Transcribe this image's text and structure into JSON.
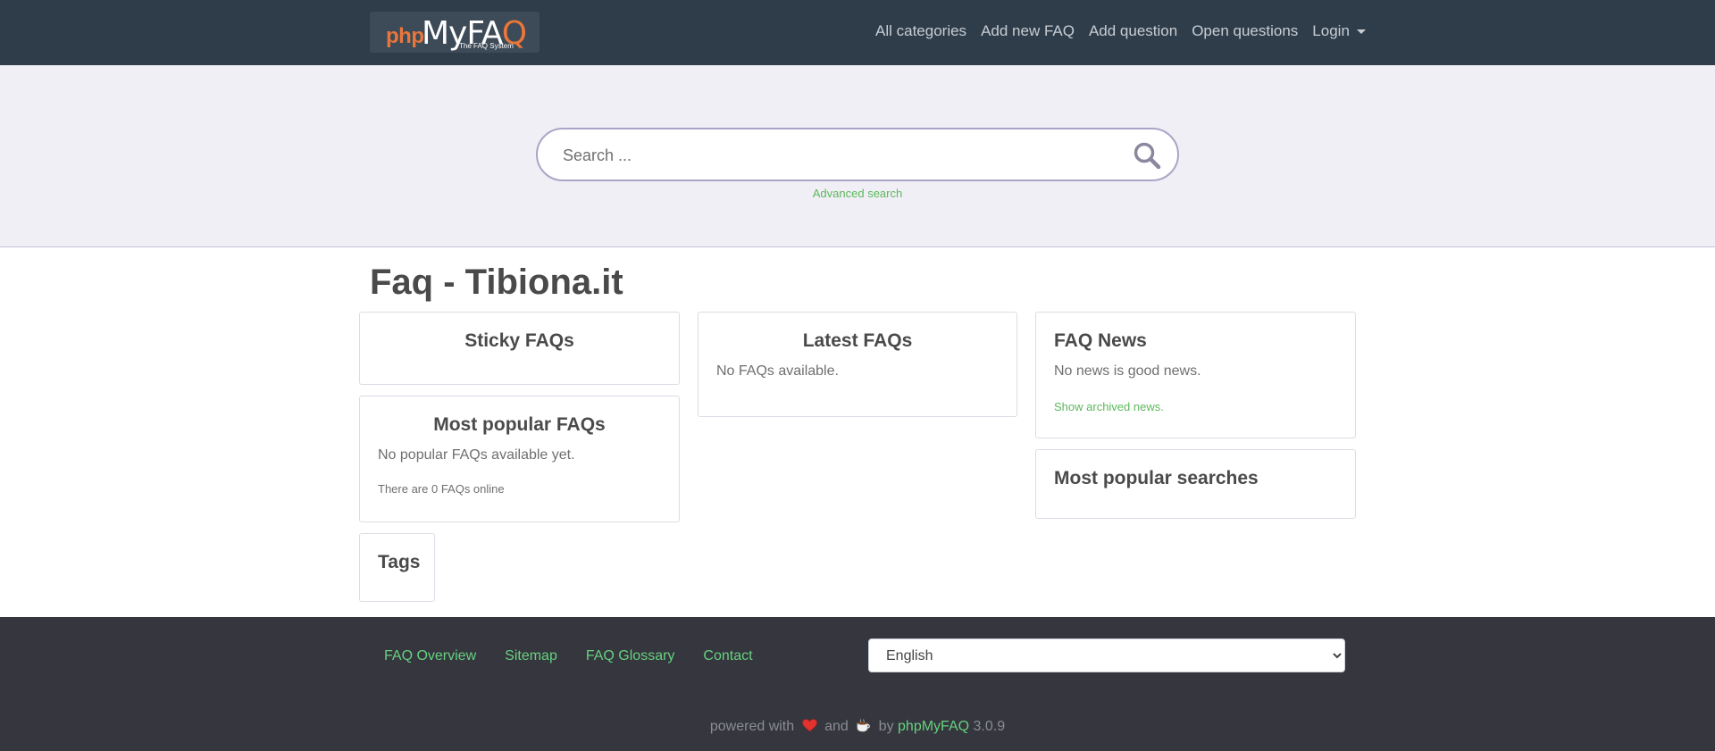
{
  "header": {
    "logo": {
      "php": "php",
      "my": "MyFA",
      "q": "Q",
      "tagline": "The FAQ System"
    },
    "nav": [
      "All categories",
      "Add new FAQ",
      "Add question",
      "Open questions"
    ],
    "login_label": "Login"
  },
  "search": {
    "placeholder": "Search ...",
    "advanced_label": "Advanced search"
  },
  "main": {
    "title": "Faq - Tibiona.it",
    "sticky": {
      "title": "Sticky FAQs"
    },
    "popular": {
      "title": "Most popular FAQs",
      "text": "No popular FAQs available yet.",
      "count_text": "There are 0 FAQs online"
    },
    "tags": {
      "title": "Tags"
    },
    "latest": {
      "title": "Latest FAQs",
      "text": "No FAQs available."
    },
    "news": {
      "title": "FAQ News",
      "text": "No news is good news.",
      "archive_link": "Show archived news."
    },
    "searches": {
      "title": "Most popular searches"
    }
  },
  "footer": {
    "links": [
      "FAQ Overview",
      "Sitemap",
      "FAQ Glossary",
      "Contact"
    ],
    "language": {
      "selected": "English",
      "options": [
        "English"
      ]
    },
    "powered": {
      "prefix": "powered with",
      "and": "and",
      "by": "by",
      "brand": "phpMyFAQ",
      "version": "3.0.9"
    }
  },
  "colors": {
    "navbar": "#2f3d4a",
    "accent_green": "#5cb85c",
    "footer": "#35363e",
    "search_band": "#f0eff5"
  }
}
